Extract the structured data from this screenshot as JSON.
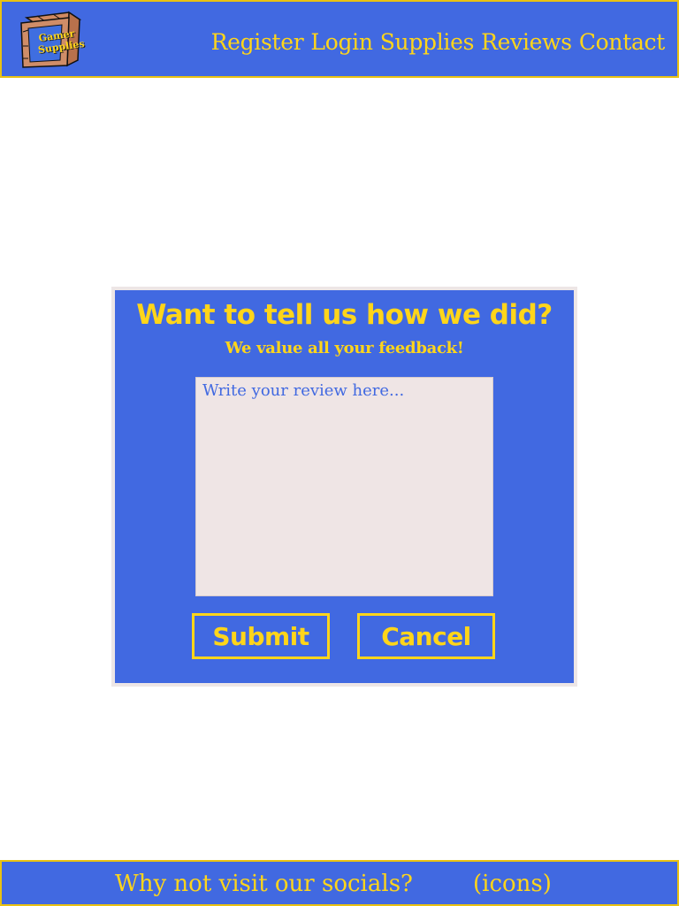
{
  "header": {
    "logo": {
      "text_line1": "Gamer",
      "text_line2": "Supplies",
      "icon": "wooden-crate-icon"
    },
    "nav": [
      {
        "label": "Register"
      },
      {
        "label": "Login"
      },
      {
        "label": "Supplies"
      },
      {
        "label": "Reviews"
      },
      {
        "label": "Contact"
      }
    ]
  },
  "review_form": {
    "title": "Want to tell us how we did?",
    "subtitle": "We value all your feedback!",
    "review_placeholder": "Write your review here...",
    "review_value": "",
    "submit_label": "Submit",
    "cancel_label": "Cancel"
  },
  "footer": {
    "text": "Why not visit our socials?",
    "icons_placeholder": "(icons)"
  },
  "colors": {
    "primary_blue": "#4169e1",
    "accent_yellow": "#ffd51a",
    "input_background": "#efe5e5",
    "card_border": "#ede6e6"
  }
}
